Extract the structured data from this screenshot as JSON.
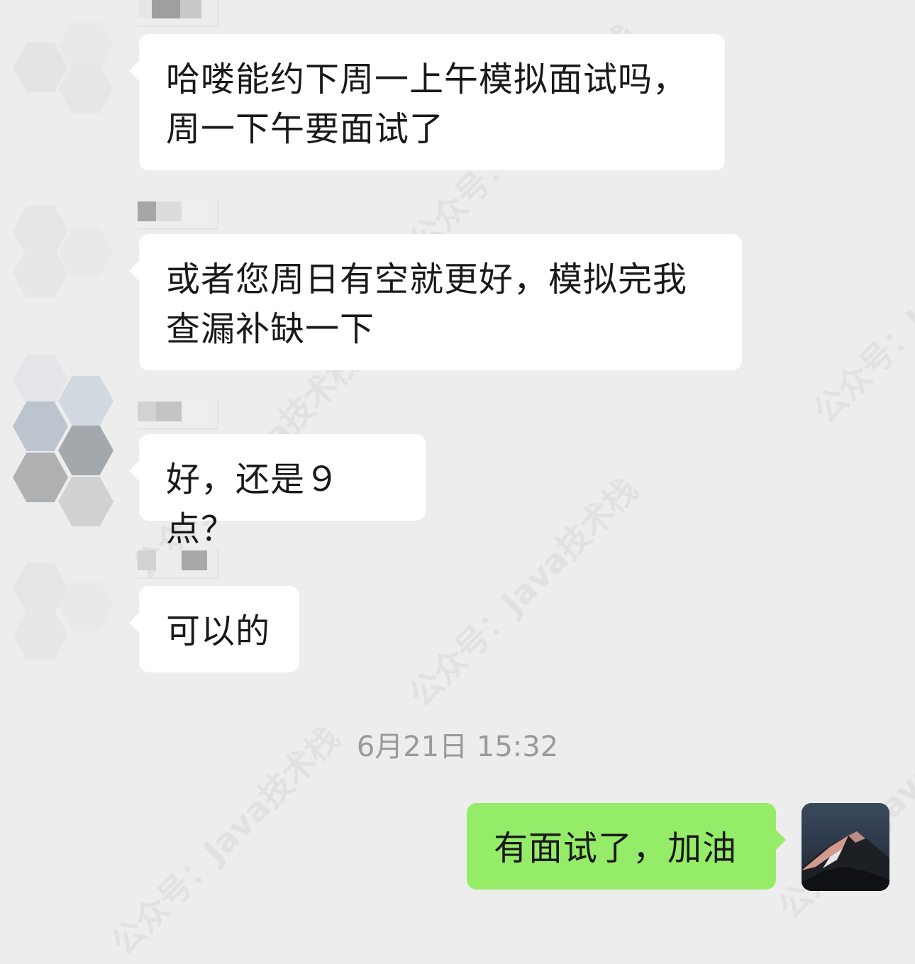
{
  "messages": [
    {
      "side": "left",
      "text_lines": [
        "哈喽能约下周一上午模拟面试吗，",
        "周一下午要面试了"
      ]
    },
    {
      "side": "left",
      "text_lines": [
        "或者您周日有空就更好，模拟完我",
        "查漏补缺一下"
      ]
    },
    {
      "side": "left",
      "text_lines": [
        "好，还是９点？"
      ]
    },
    {
      "side": "left",
      "text_lines": [
        "可以的"
      ]
    },
    {
      "side": "right",
      "text_lines": [
        "有面试了，加油"
      ]
    }
  ],
  "timestamp": "6月21日 15:32",
  "watermark": {
    "text": "公众号：Java技术栈"
  },
  "colors": {
    "background": "#ededed",
    "incoming_bubble": "#ffffff",
    "outgoing_bubble": "#95ec69",
    "timestamp": "#9a9a9a"
  }
}
